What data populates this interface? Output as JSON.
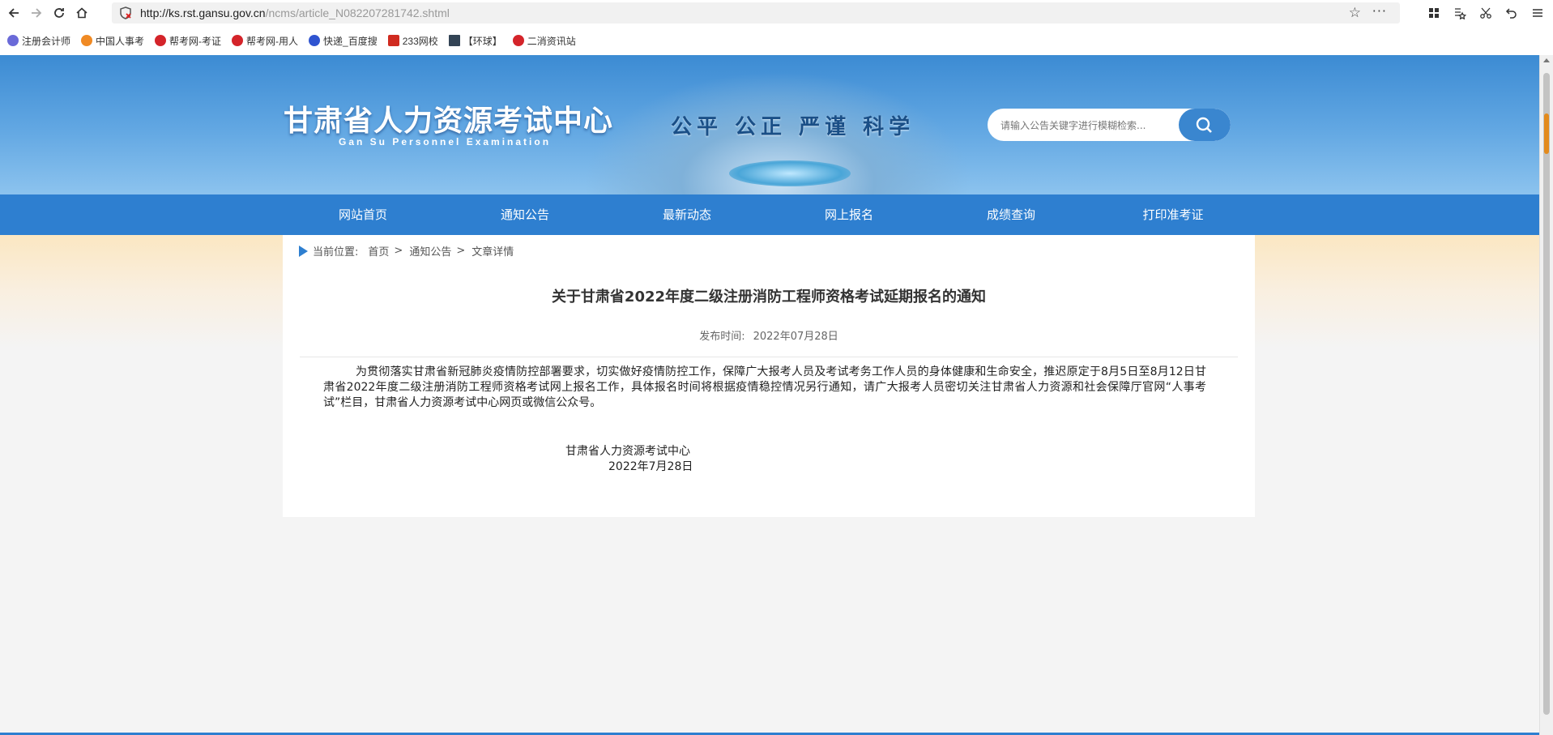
{
  "browser": {
    "url_host": "http://ks.rst.gansu.gov.cn",
    "url_path": "/ncms/article_N082207281742.shtml",
    "bookmarks": [
      {
        "label": "注册会计师",
        "color": "#6a6ad8"
      },
      {
        "label": "中国人事考",
        "color": "#f08a24"
      },
      {
        "label": "帮考网-考证",
        "color": "#d4242a"
      },
      {
        "label": "帮考网-用人",
        "color": "#d4242a"
      },
      {
        "label": "快递_百度搜",
        "color": "#2f54d0"
      },
      {
        "label": "233网校",
        "color": "#d02b20"
      },
      {
        "label": "【环球】",
        "color": "#334455"
      },
      {
        "label": "二消资讯站",
        "color": "#d4242a"
      }
    ]
  },
  "header": {
    "title": "甘肃省人力资源考试中心",
    "subtitle": "Gan Su Personnel Examination",
    "motto": "公平 公正 严谨 科学",
    "search_placeholder": "请输入公告关键字进行模糊检索..."
  },
  "nav": [
    "网站首页",
    "通知公告",
    "最新动态",
    "网上报名",
    "成绩查询",
    "打印准考证"
  ],
  "breadcrumb": {
    "prefix": "当前位置:",
    "items": [
      "首页",
      "通知公告",
      "文章详情"
    ]
  },
  "article": {
    "title": "关于甘肃省2022年度二级注册消防工程师资格考试延期报名的通知",
    "date_label": "发布时间:",
    "date": "2022年07月28日",
    "body": "为贯彻落实甘肃省新冠肺炎疫情防控部署要求，切实做好疫情防控工作，保障广大报考人员及考试考务工作人员的身体健康和生命安全，推迟原定于8月5日至8月12日甘肃省2022年度二级注册消防工程师资格考试网上报名工作，具体报名时间将根据疫情稳控情况另行通知，请广大报考人员密切关注甘肃省人力资源和社会保障厅官网“人事考试”栏目，甘肃省人力资源考试中心网页或微信公众号。",
    "sign_org": "甘肃省人力资源考试中心",
    "sign_date": "2022年7月28日"
  }
}
